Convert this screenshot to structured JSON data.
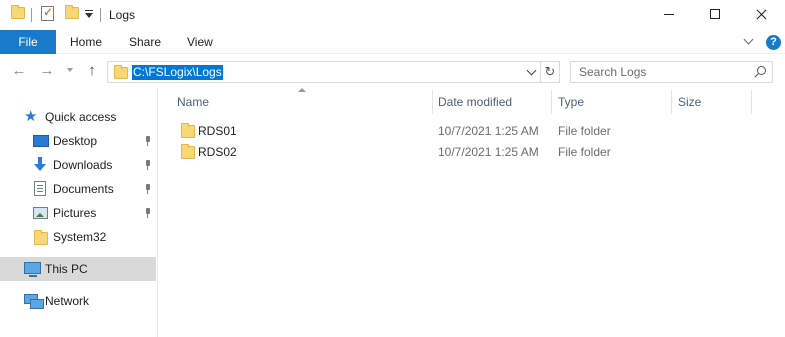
{
  "window": {
    "title": "Logs",
    "controls": {
      "minimize": "minimize",
      "maximize": "maximize",
      "close": "close"
    }
  },
  "ribbon": {
    "tabs": [
      {
        "label": "File",
        "active": true
      },
      {
        "label": "Home"
      },
      {
        "label": "Share"
      },
      {
        "label": "View"
      }
    ],
    "help_label": "?"
  },
  "address": {
    "path": "C:\\FSLogix\\Logs",
    "search_placeholder": "Search Logs"
  },
  "nav_pane": {
    "items": [
      {
        "label": "Quick access",
        "icon": "star-icon"
      },
      {
        "label": "Desktop",
        "icon": "desktop-icon",
        "pinned": true
      },
      {
        "label": "Downloads",
        "icon": "downloads-icon",
        "pinned": true
      },
      {
        "label": "Documents",
        "icon": "documents-icon",
        "pinned": true
      },
      {
        "label": "Pictures",
        "icon": "pictures-icon",
        "pinned": true
      },
      {
        "label": "System32",
        "icon": "folder-icon"
      },
      {
        "label": "This PC",
        "icon": "pc-icon",
        "selected": true
      },
      {
        "label": "Network",
        "icon": "network-icon"
      }
    ]
  },
  "file_list": {
    "columns": [
      "Name",
      "Date modified",
      "Type",
      "Size"
    ],
    "rows": [
      {
        "name": "RDS01",
        "date": "10/7/2021 1:25 AM",
        "type": "File folder",
        "size": ""
      },
      {
        "name": "RDS02",
        "date": "10/7/2021 1:25 AM",
        "type": "File folder",
        "size": ""
      }
    ]
  },
  "colors": {
    "accent": "#1979ca",
    "selection": "#0078d7",
    "nav_selected": "#d9d9d9",
    "column_header_text": "#4c607a",
    "folder": "#f8d775"
  }
}
